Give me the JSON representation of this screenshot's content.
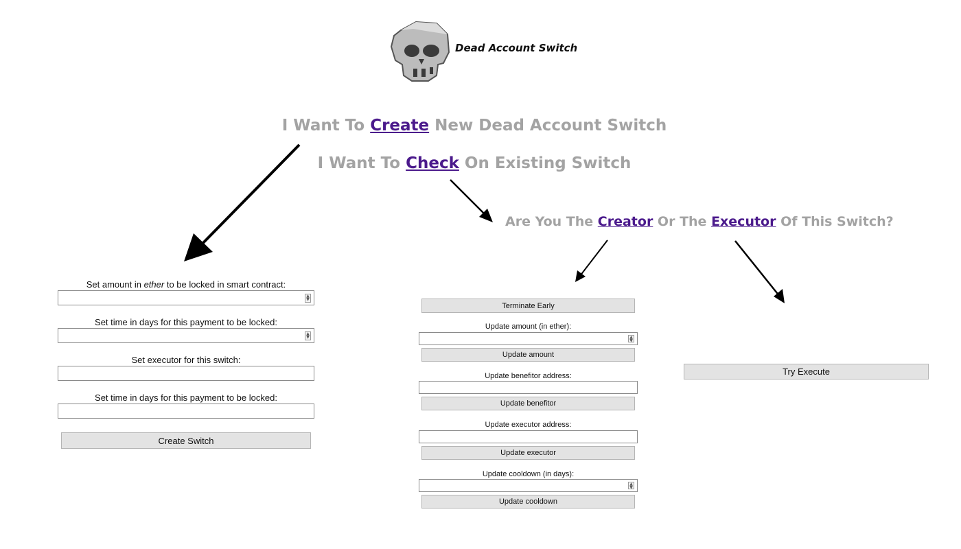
{
  "header": {
    "title": "Dead Account Switch",
    "logo_icon": "skull-icon"
  },
  "headings": {
    "create": {
      "before": "I Want To ",
      "link": "Create",
      "after": " New Dead Account Switch"
    },
    "check": {
      "before": "I Want To ",
      "link": "Check",
      "after": " On Existing Switch"
    },
    "role": {
      "before": "Are You The ",
      "link1": "Creator",
      "middle": " Or The ",
      "link2": "Executor",
      "after": " Of This Switch?"
    }
  },
  "create_form": {
    "amount_label_before": "Set amount in ",
    "amount_label_em": "ether",
    "amount_label_after": " to be locked in smart contract:",
    "time_label": "Set time in days for this payment to be locked:",
    "executor_label": "Set executor for this switch:",
    "time_label_2": "Set time in days for this payment to be locked:",
    "submit_label": "Create Switch"
  },
  "creator_panel": {
    "terminate_label": "Terminate Early",
    "amount_label": "Update amount (in ether):",
    "amount_button": "Update amount",
    "benefitor_label": "Update benefitor address:",
    "benefitor_button": "Update benefitor",
    "executor_label": "Update executor address:",
    "executor_button": "Update executor",
    "cooldown_label": "Update cooldown (in days):",
    "cooldown_button": "Update cooldown"
  },
  "executor_panel": {
    "execute_label": "Try Execute"
  },
  "colors": {
    "heading_gray": "#a3a3a3",
    "link_purple": "#4b1a8c",
    "button_bg": "#e3e3e3"
  }
}
